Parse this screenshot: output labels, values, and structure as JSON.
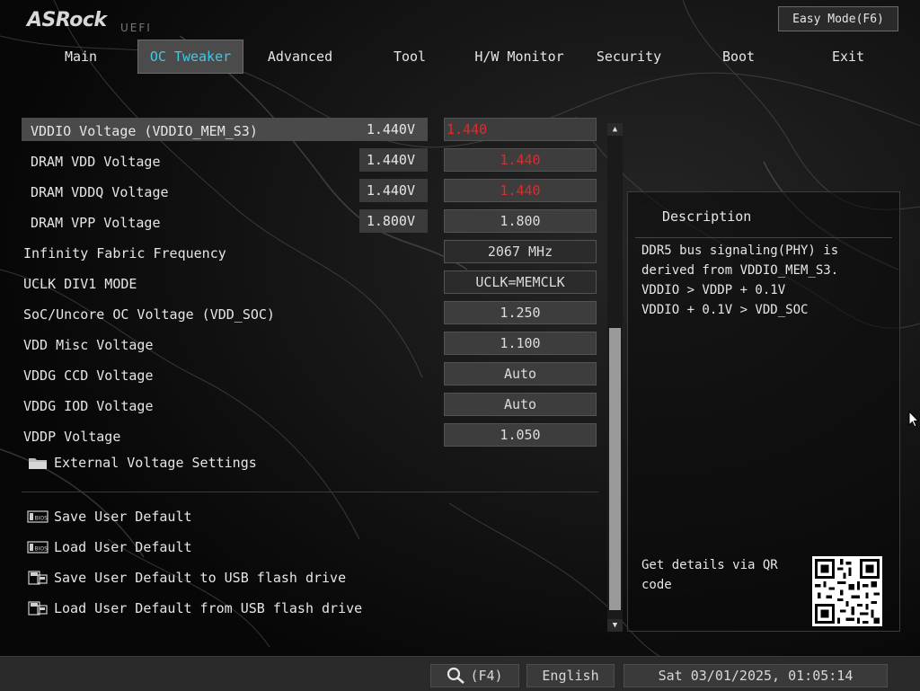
{
  "brand": {
    "name": "ASRock",
    "sub": "UEFI"
  },
  "easy_mode_label": "Easy Mode(F6)",
  "tabs": [
    {
      "label": "Main"
    },
    {
      "label": "OC Tweaker"
    },
    {
      "label": "Advanced"
    },
    {
      "label": "Tool"
    },
    {
      "label": "H/W Monitor"
    },
    {
      "label": "Security"
    },
    {
      "label": "Boot"
    },
    {
      "label": "Exit"
    }
  ],
  "active_tab": "OC Tweaker",
  "settings": [
    {
      "label": "VDDIO Voltage (VDDIO_MEM_S3)",
      "current": "1.440V",
      "value": "1.440"
    },
    {
      "label": "DRAM VDD Voltage",
      "current": "1.440V",
      "value": "1.440"
    },
    {
      "label": "DRAM VDDQ Voltage",
      "current": "1.440V",
      "value": "1.440"
    },
    {
      "label": "DRAM VPP Voltage",
      "current": "1.800V",
      "value": "1.800"
    },
    {
      "label": "Infinity Fabric Frequency",
      "value": "2067 MHz"
    },
    {
      "label": "UCLK DIV1 MODE",
      "value": "UCLK=MEMCLK"
    },
    {
      "label": "SoC/Uncore OC Voltage (VDD_SOC)",
      "value": "1.250"
    },
    {
      "label": "VDD Misc Voltage",
      "value": "1.100"
    },
    {
      "label": "VDDG CCD Voltage",
      "value": "Auto"
    },
    {
      "label": "VDDG IOD Voltage",
      "value": "Auto"
    },
    {
      "label": "VDDP Voltage",
      "value": "1.050"
    }
  ],
  "submenu": {
    "label": "External Voltage Settings",
    "icon": "folder-icon"
  },
  "actions": [
    {
      "label": "Save User Default",
      "icon": "bios-icon"
    },
    {
      "label": "Load User Default",
      "icon": "bios-icon"
    },
    {
      "label": "Save User Default to USB flash drive",
      "icon": "usb-drive-icon"
    },
    {
      "label": "Load User Default from USB flash drive",
      "icon": "usb-drive-icon"
    }
  ],
  "description": {
    "title": "Description",
    "lines": [
      "DDR5 bus signaling(PHY) is",
      "derived from VDDIO_MEM_S3.",
      "VDDIO > VDDP + 0.1V",
      "VDDIO + 0.1V > VDD_SOC"
    ],
    "qr_text": [
      "Get details via QR",
      "code"
    ]
  },
  "footer": {
    "search_label": "(F4)",
    "language": "English",
    "datetime": "Sat 03/01/2025, 01:05:14"
  },
  "colors": {
    "accent": "#42c8e6",
    "warning_value": "#e02b2b",
    "panel": "#3d3d3d"
  }
}
